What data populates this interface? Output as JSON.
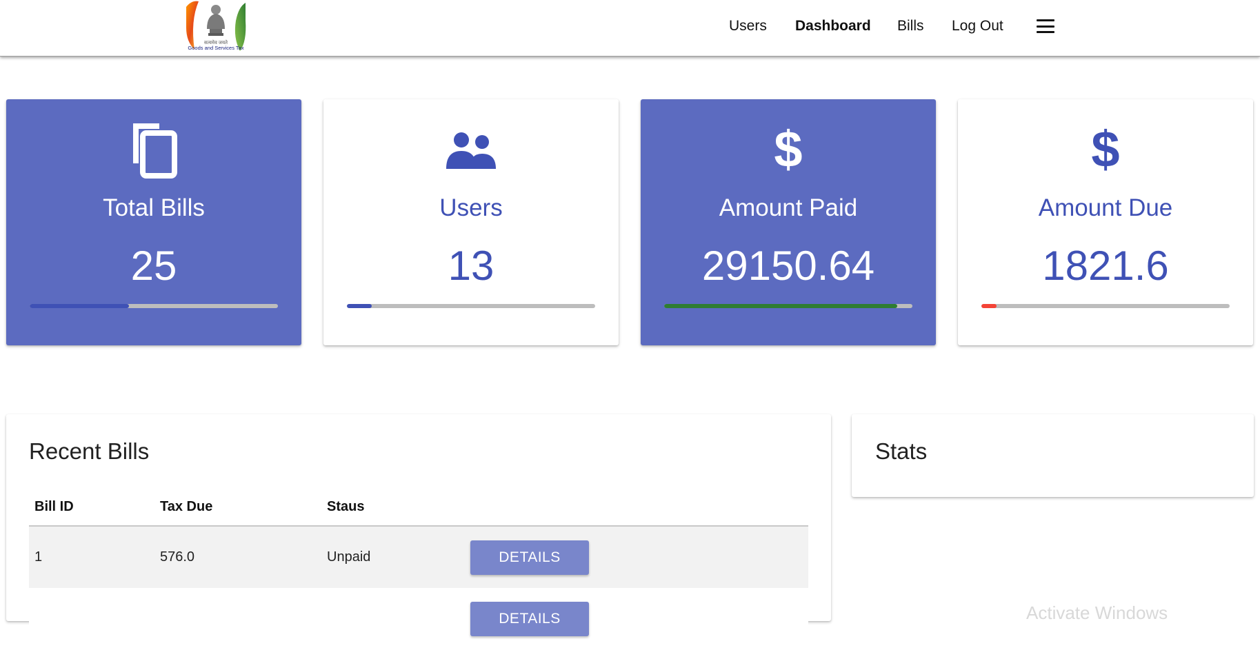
{
  "header": {
    "logo_text": "Goods and Services Tax",
    "nav": [
      {
        "label": "Users",
        "active": false
      },
      {
        "label": "Dashboard",
        "active": true
      },
      {
        "label": "Bills",
        "active": false
      },
      {
        "label": "Log Out",
        "active": false
      }
    ],
    "menu_icon": "hamburger-menu-icon"
  },
  "cards": [
    {
      "icon": "copy-icon",
      "label": "Total Bills",
      "value": "25",
      "style": "filled",
      "progress": 0.4,
      "progress_color": "#3f51b5"
    },
    {
      "icon": "people-icon",
      "label": "Users",
      "value": "13",
      "style": "plain",
      "progress": 0.1,
      "progress_color": "#3f51b5"
    },
    {
      "icon": "dollar-icon",
      "label": "Amount Paid",
      "value": "29150.64",
      "style": "filled",
      "progress": 0.94,
      "progress_color": "#2e7d32"
    },
    {
      "icon": "dollar-icon",
      "label": "Amount Due",
      "value": "1821.6",
      "style": "plain",
      "progress": 0.06,
      "progress_color": "#f44336"
    }
  ],
  "recent_bills": {
    "title": "Recent Bills",
    "columns": [
      "Bill ID",
      "Tax Due",
      "Staus",
      ""
    ],
    "rows": [
      {
        "id": "1",
        "tax_due": "576.0",
        "status": "Unpaid",
        "action": "DETAILS"
      },
      {
        "id": "",
        "tax_due": "",
        "status": "",
        "action": "DETAILS"
      }
    ]
  },
  "stats": {
    "title": "Stats"
  },
  "watermark": "Activate Windows",
  "colors": {
    "accent": "#5c6bc0",
    "primary": "#3f51b5",
    "button": "#7986cb",
    "paid": "#2e7d32",
    "due": "#f44336"
  }
}
